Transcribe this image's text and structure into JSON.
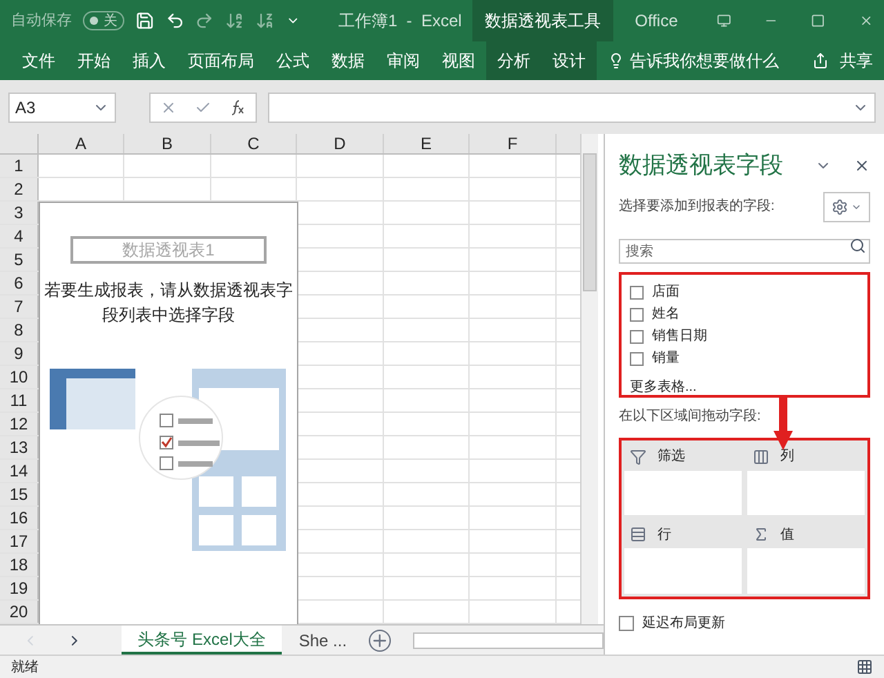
{
  "title_bar": {
    "autosave_label": "自动保存",
    "autosave_toggle": {
      "label": "关",
      "on": false
    },
    "title": "工作簿1  -  Excel",
    "context_group": "数据透视表工具",
    "account": "Office"
  },
  "ribbon_tabs": [
    {
      "label": "文件",
      "contextual": false
    },
    {
      "label": "开始",
      "contextual": false
    },
    {
      "label": "插入",
      "contextual": false
    },
    {
      "label": "页面布局",
      "contextual": false
    },
    {
      "label": "公式",
      "contextual": false
    },
    {
      "label": "数据",
      "contextual": false
    },
    {
      "label": "审阅",
      "contextual": false
    },
    {
      "label": "视图",
      "contextual": false
    },
    {
      "label": "分析",
      "contextual": true
    },
    {
      "label": "设计",
      "contextual": true
    }
  ],
  "tell_me": "告诉我你想要做什么",
  "share": "共享",
  "formula_bar": {
    "name_box": "A3"
  },
  "grid": {
    "columns": [
      "A",
      "B",
      "C",
      "D",
      "E",
      "F"
    ],
    "rows": [
      "1",
      "2",
      "3",
      "4",
      "5",
      "6",
      "7",
      "8",
      "9",
      "10",
      "11",
      "12",
      "13",
      "14",
      "15",
      "16",
      "17",
      "18",
      "19",
      "20"
    ]
  },
  "pivot_placeholder": {
    "title": "数据透视表1",
    "message": "若要生成报表，请从数据透视表字段列表中选择字段"
  },
  "sheet_tabs": [
    {
      "label": "头条号 Excel大全",
      "selected": true
    },
    {
      "label": "She ...",
      "selected": false
    }
  ],
  "status": "就绪",
  "field_pane": {
    "title": "数据透视表字段",
    "subtitle": "选择要添加到报表的字段:",
    "search_placeholder": "搜索",
    "fields": [
      {
        "label": "店面",
        "checked": false
      },
      {
        "label": "姓名",
        "checked": false
      },
      {
        "label": "销售日期",
        "checked": false
      },
      {
        "label": "销量",
        "checked": false
      }
    ],
    "more_tables": "更多表格...",
    "areas_label": "在以下区域间拖动字段:",
    "areas": [
      {
        "kind": "filter",
        "label": "筛选"
      },
      {
        "kind": "columns",
        "label": "列"
      },
      {
        "kind": "rows",
        "label": "行"
      },
      {
        "kind": "values",
        "label": "值"
      }
    ],
    "defer_update": {
      "label": "延迟布局更新",
      "checked": false
    }
  }
}
